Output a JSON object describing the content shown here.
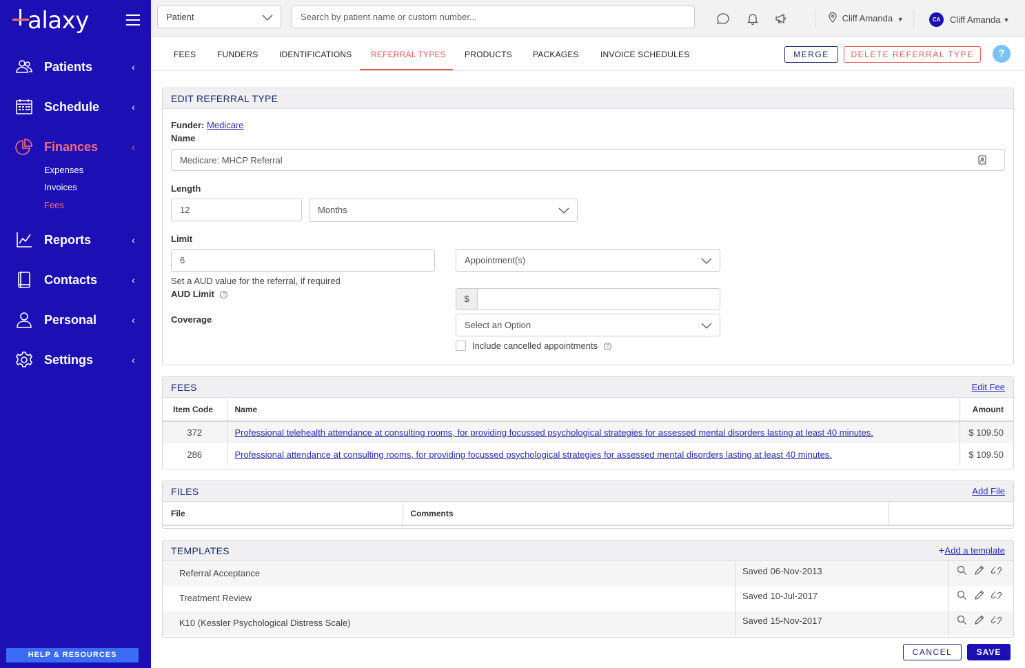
{
  "brand": {
    "name": "Halaxy"
  },
  "sidebar": {
    "items": [
      {
        "label": "Patients",
        "icon": "patients-icon"
      },
      {
        "label": "Schedule",
        "icon": "calendar-icon"
      },
      {
        "label": "Finances",
        "icon": "pie-chart-icon",
        "active": true,
        "sub": [
          "Expenses",
          "Invoices",
          "Fees"
        ],
        "active_sub": "Fees"
      },
      {
        "label": "Reports",
        "icon": "chart-icon"
      },
      {
        "label": "Contacts",
        "icon": "book-icon"
      },
      {
        "label": "Personal",
        "icon": "person-icon"
      },
      {
        "label": "Settings",
        "icon": "gear-icon"
      }
    ],
    "help_label": "HELP & RESOURCES"
  },
  "topbar": {
    "patient_select": "Patient",
    "search_placeholder": "Search by patient name or custom number...",
    "location": "Cliff Amanda",
    "user_initials": "CA",
    "user_name": "Cliff Amanda"
  },
  "tabs": [
    "FEES",
    "FUNDERS",
    "IDENTIFICATIONS",
    "REFERRAL TYPES",
    "PRODUCTS",
    "PACKAGES",
    "INVOICE SCHEDULES"
  ],
  "active_tab": "REFERRAL TYPES",
  "actions": {
    "merge": "MERGE",
    "delete": "DELETE REFERRAL TYPE",
    "help": "?"
  },
  "edit": {
    "title": "EDIT REFERRAL TYPE",
    "funder_label": "Funder:",
    "funder_value": "Medicare",
    "name_label": "Name",
    "name_value": "Medicare: MHCP Referral",
    "length_label": "Length",
    "length_value": "12",
    "length_unit": "Months",
    "limit_label": "Limit",
    "limit_value": "6",
    "limit_unit": "Appointment(s)",
    "aud_hint": "Set a AUD value for the referral, if required",
    "aud_label": "AUD Limit",
    "currency": "$",
    "coverage_label": "Coverage",
    "coverage_placeholder": "Select an Option",
    "include_cancelled": "Include cancelled appointments"
  },
  "fees": {
    "title": "FEES",
    "action": "Edit Fee",
    "headers": [
      "Item Code",
      "Name",
      "Amount"
    ],
    "rows": [
      {
        "code": "372",
        "name": "Professional telehealth attendance at consulting rooms, for providing focussed psychological strategies for assessed mental disorders lasting at least 40 minutes.",
        "amount": "$ 109.50"
      },
      {
        "code": "286",
        "name": "Professional attendance at consulting rooms, for providing focussed psychological strategies for assessed mental disorders lasting at least 40 minutes.",
        "amount": "$ 109.50"
      }
    ]
  },
  "files": {
    "title": "FILES",
    "action": "Add File",
    "headers": [
      "File",
      "Comments"
    ]
  },
  "templates": {
    "title": "TEMPLATES",
    "action": "Add a template",
    "rows": [
      {
        "name": "Referral Acceptance",
        "saved": "Saved 06-Nov-2013"
      },
      {
        "name": "Treatment Review",
        "saved": "Saved 10-Jul-2017"
      },
      {
        "name": "K10 (Kessler Psychological Distress Scale)",
        "saved": "Saved 15-Nov-2017"
      }
    ]
  },
  "footer": {
    "cancel": "CANCEL",
    "save": "SAVE"
  }
}
